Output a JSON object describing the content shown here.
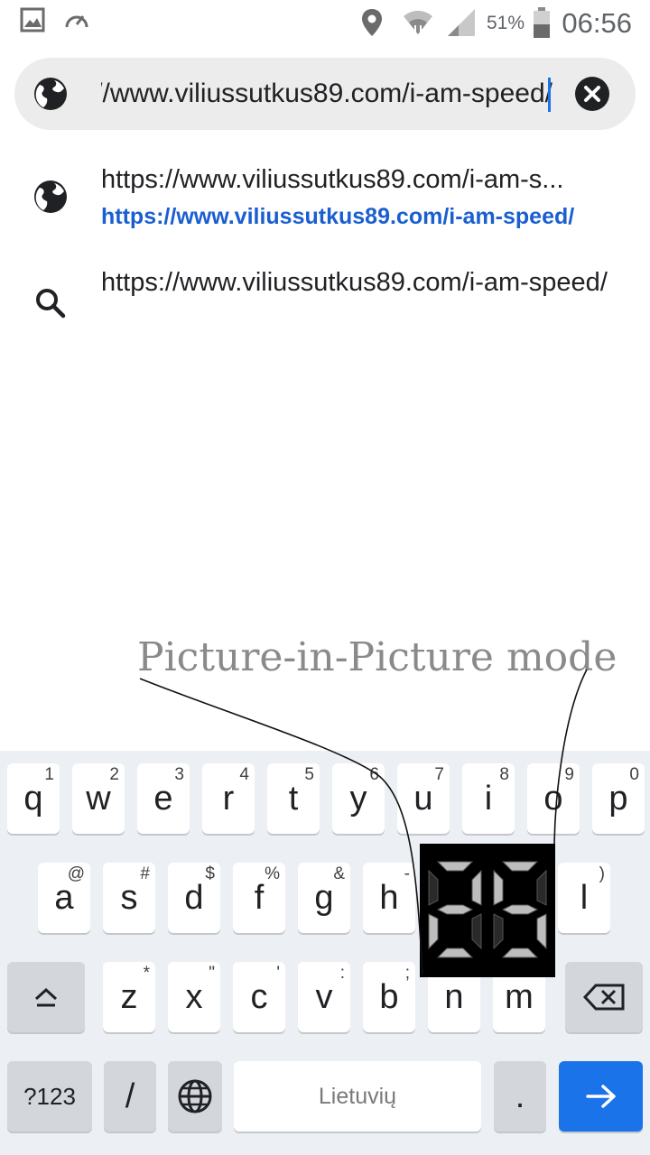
{
  "status_bar": {
    "battery_percent": "51%",
    "time": "06:56",
    "icons": [
      "image-icon",
      "speedometer-icon",
      "location-icon",
      "wifi-icon",
      "signal-icon",
      "battery-icon"
    ]
  },
  "url_bar": {
    "value": "https://www.viliussutkus89.com/i-am-speed/",
    "icon": "globe-icon",
    "clear_icon": "clear-icon"
  },
  "suggestions": [
    {
      "icon": "globe-icon",
      "title": "https://www.viliussutkus89.com/i-am-s...",
      "url": "https://www.viliussutkus89.com/i-am-speed/"
    },
    {
      "icon": "search-icon",
      "text": "https://www.viliussutkus89.com/i-am-speed/"
    }
  ],
  "pip_caption": "Picture-in-Picture mode",
  "pip_display": {
    "value": "25"
  },
  "keyboard": {
    "row1": [
      {
        "key": "q",
        "hint": "1"
      },
      {
        "key": "w",
        "hint": "2"
      },
      {
        "key": "e",
        "hint": "3"
      },
      {
        "key": "r",
        "hint": "4"
      },
      {
        "key": "t",
        "hint": "5"
      },
      {
        "key": "y",
        "hint": "6"
      },
      {
        "key": "u",
        "hint": "7"
      },
      {
        "key": "i",
        "hint": "8"
      },
      {
        "key": "o",
        "hint": "9"
      },
      {
        "key": "p",
        "hint": "0"
      }
    ],
    "row2": [
      {
        "key": "a",
        "hint": "@"
      },
      {
        "key": "s",
        "hint": "#"
      },
      {
        "key": "d",
        "hint": "$"
      },
      {
        "key": "f",
        "hint": "%"
      },
      {
        "key": "g",
        "hint": "&"
      },
      {
        "key": "h",
        "hint": "-"
      },
      {
        "key": "l",
        "hint": ")"
      }
    ],
    "row3": [
      {
        "key": "z",
        "hint": "*"
      },
      {
        "key": "x",
        "hint": "\""
      },
      {
        "key": "c",
        "hint": "'"
      },
      {
        "key": "v",
        "hint": ":"
      },
      {
        "key": "b",
        "hint": ";"
      },
      {
        "key": "n",
        "hint": ""
      },
      {
        "key": "m",
        "hint": ""
      }
    ],
    "symbols_label": "?123",
    "slash_label": "/",
    "space_label": "Lietuvių",
    "period_label": "."
  }
}
